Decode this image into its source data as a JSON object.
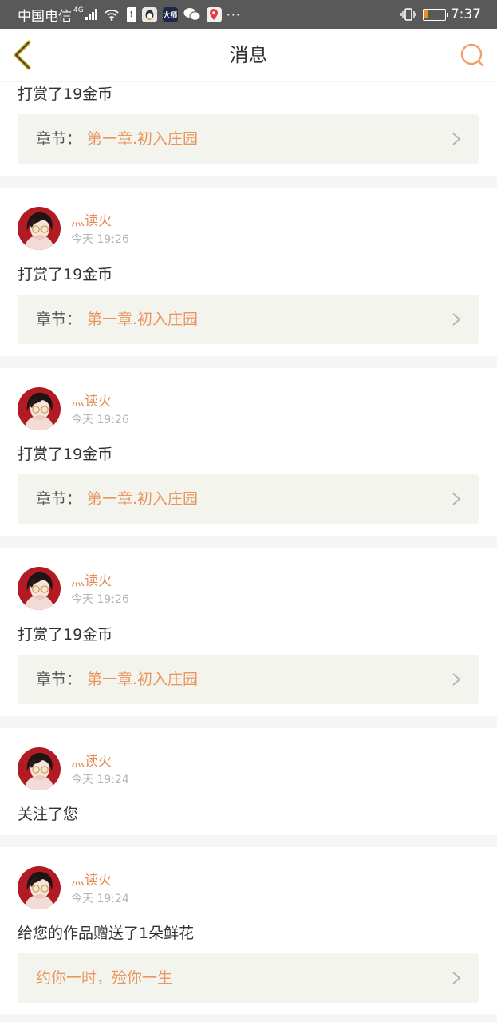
{
  "status_bar": {
    "carrier": "中国电信",
    "network": "4G",
    "time": "7:37",
    "battery_level": 0.2,
    "icons": [
      "signal-icon",
      "wifi-icon",
      "alert-icon",
      "qq-icon",
      "dashi-icon",
      "wechat-icon",
      "map-pin-icon",
      "more-dots-icon",
      "vibrate-icon",
      "battery-icon"
    ],
    "app_badge_dashi": "大师",
    "more_dots": "···"
  },
  "nav": {
    "title": "消息",
    "back_icon": "chevron-left-icon",
    "search_icon": "search-icon"
  },
  "colors": {
    "accent": "#e38b57",
    "chapter_bg": "#f4f4ee",
    "back_arrow": "#c8a516"
  },
  "chapter_label": "章节：",
  "messages": [
    {
      "text": "打赏了19金币",
      "chapter": "第一章.初入庄园"
    },
    {
      "user": "灬读火",
      "time": "今天 19:26",
      "text": "打赏了19金币",
      "chapter": "第一章.初入庄园"
    },
    {
      "user": "灬读火",
      "time": "今天 19:26",
      "text": "打赏了19金币",
      "chapter": "第一章.初入庄园"
    },
    {
      "user": "灬读火",
      "time": "今天 19:26",
      "text": "打赏了19金币",
      "chapter": "第一章.初入庄园"
    },
    {
      "user": "灬读火",
      "time": "今天 19:24",
      "text": "关注了您"
    },
    {
      "user": "灬读火",
      "time": "今天 19:24",
      "text": "给您的作品赠送了1朵鲜花",
      "quote": "约你一时，殓你一生"
    }
  ]
}
